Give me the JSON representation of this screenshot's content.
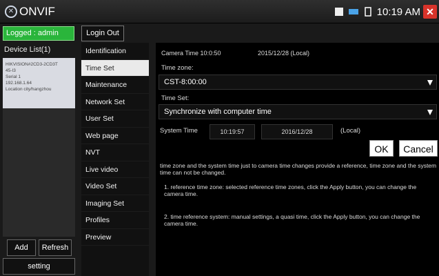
{
  "titlebar": {
    "app_title": "ONVIF",
    "time": "10:19 AM"
  },
  "session": {
    "logged_in": "Logged : admin",
    "login_out": "Login Out"
  },
  "device_list": {
    "title": "Device List(1)",
    "card_lines": [
      "HIKVISION#2CD3-2CD3T",
      "45-I3",
      "Serial 1",
      "192.168.1.64",
      "Location city/hangzhou"
    ]
  },
  "left_buttons": {
    "add": "Add",
    "refresh": "Refresh",
    "setting": "setting"
  },
  "menu": {
    "items": [
      "Identification",
      "Time Set",
      "Maintenance",
      "Network Set",
      "User Set",
      "Web page",
      "NVT",
      "Live video",
      "Video Set",
      "Imaging Set",
      "Profiles",
      "Preview"
    ],
    "active_index": 1
  },
  "content": {
    "camera_time_label": "Camera Time 10:0:50",
    "camera_date": "2015/12/28 (Local)",
    "timezone_label": "Time zone:",
    "timezone_value": "CST-8:00:00",
    "timeset_label": "Time Set:",
    "timeset_value": "Synchronize with computer time",
    "system_time_label": "System Time",
    "system_time_value": "10:19:57",
    "system_date_value": "2016/12/28",
    "local_label": "(Local)",
    "ok": "OK",
    "cancel": "Cancel",
    "help_main": "time zone and the system time just to camera time changes provide a reference, time zone and the system time can not be changed.",
    "help_1": "1. reference time zone: selected reference time zones, click the Apply button, you can change the camera time.",
    "help_2": "2. time reference system: manual settings, a quasi time, click the Apply button, you can change the camera time."
  }
}
